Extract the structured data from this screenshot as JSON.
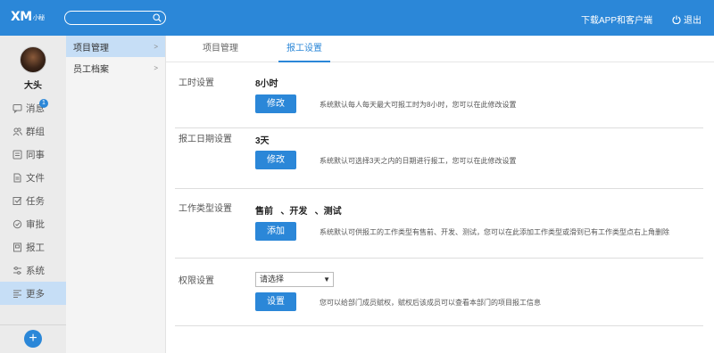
{
  "header": {
    "logo_main": "XM",
    "logo_sub": "小秘",
    "search_placeholder": "",
    "download_label": "下载APP和客户端",
    "logout_label": "退出"
  },
  "user": {
    "name": "大头"
  },
  "sidebar": {
    "items": [
      {
        "label": "消息",
        "icon": "message-icon",
        "badge": "1"
      },
      {
        "label": "群组",
        "icon": "group-icon"
      },
      {
        "label": "同事",
        "icon": "colleague-icon"
      },
      {
        "label": "文件",
        "icon": "file-icon"
      },
      {
        "label": "任务",
        "icon": "task-icon"
      },
      {
        "label": "审批",
        "icon": "approval-icon"
      },
      {
        "label": "报工",
        "icon": "report-icon"
      },
      {
        "label": "系统",
        "icon": "system-icon"
      },
      {
        "label": "更多",
        "icon": "more-icon"
      }
    ],
    "add_label": "+"
  },
  "subnav": {
    "items": [
      {
        "label": "项目管理",
        "arrow": ">"
      },
      {
        "label": "员工档案",
        "arrow": ">"
      }
    ]
  },
  "tabs": [
    {
      "label": "项目管理"
    },
    {
      "label": "报工设置"
    }
  ],
  "settings": {
    "work_hours": {
      "label": "工时设置",
      "value": "8小时",
      "button": "修改",
      "desc": "系统默认每人每天最大可报工时为8小时，您可以在此修改设置"
    },
    "report_date": {
      "label": "报工日期设置",
      "value": "3天",
      "button": "修改",
      "desc": "系统默认可选择3天之内的日期进行报工，您可以在此修改设置"
    },
    "work_type": {
      "label": "工作类型设置",
      "value": "售前   、开发   、测试",
      "button": "添加",
      "desc": "系统默认可供报工的工作类型有售前、开发、测试，您可以在此添加工作类型或滑到已有工作类型点右上角删除"
    },
    "permission": {
      "label": "权限设置",
      "select_value": "请选择",
      "button": "设置",
      "desc": "您可以给部门成员赋权，赋权后该成员可以查看本部门的项目报工信息"
    }
  },
  "colors": {
    "accent": "#2b87d8",
    "active_bg": "#c6def6"
  }
}
